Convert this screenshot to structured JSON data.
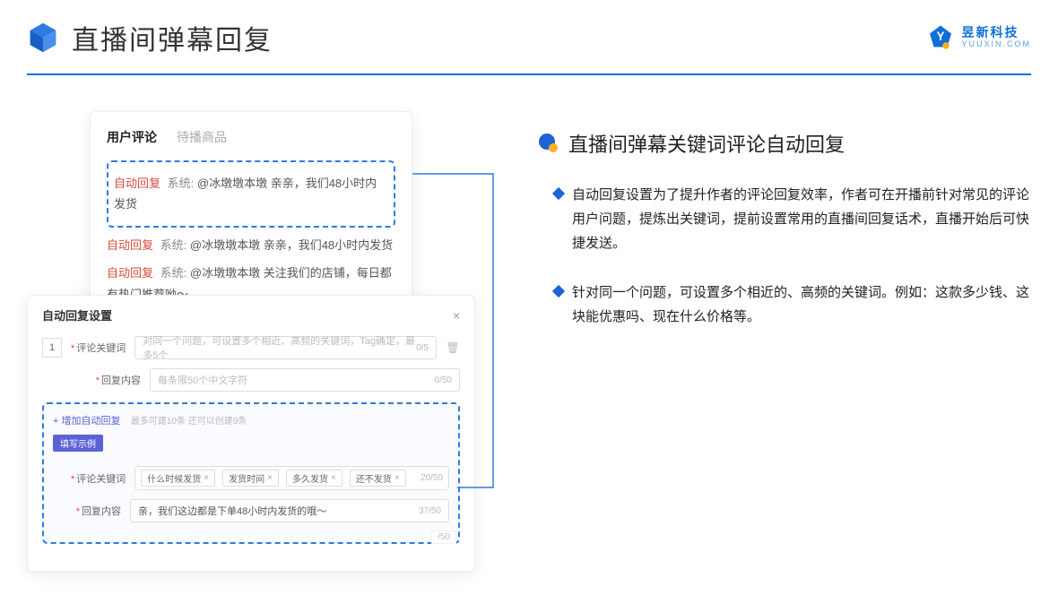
{
  "header": {
    "title": "直播间弹幕回复",
    "brand_name": "昱新科技",
    "brand_sub": "YUUXIN.COM"
  },
  "comments_card": {
    "tab_active": "用户评论",
    "tab_inactive": "待播商品",
    "highlight": {
      "tag": "自动回复",
      "sys": "系统:",
      "body": "@冰墩墩本墩 亲亲，我们48小时内发货"
    },
    "items": [
      {
        "tag": "自动回复",
        "sys": "系统:",
        "body": "@冰墩墩本墩 亲亲，我们48小时内发货"
      },
      {
        "tag": "自动回复",
        "sys": "系统:",
        "body": "@冰墩墩本墩 关注我们的店铺，每日都有热门推荐呦～"
      }
    ]
  },
  "settings": {
    "title": "自动回复设置",
    "idx": "1",
    "kw_label": "评论关键词",
    "kw_placeholder": "对同一个问题，可设置多个相近、高频的关键词，Tag确定，最多5个",
    "kw_count": "0/5",
    "rc_label": "回复内容",
    "rc_placeholder": "每条限50个中文字符",
    "rc_count": "0/50",
    "add_link": "+ 增加自动回复",
    "add_hint": "最多可建10条 还可以创建9条",
    "example_btn": "填写示例",
    "ex_kw_label": "评论关键词",
    "ex_chips": [
      "什么时候发货",
      "发货时间",
      "多久发货",
      "还不发货"
    ],
    "ex_kw_count": "20/50",
    "ex_rc_label": "回复内容",
    "ex_rc_value": "亲，我们这边都是下单48小时内发货的哦～",
    "ex_rc_count": "37/50",
    "ghost_count": "/50"
  },
  "right": {
    "section_title": "直播间弹幕关键词评论自动回复",
    "bullets": [
      "自动回复设置为了提升作者的评论回复效率，作者可在开播前针对常见的评论用户问题，提炼出关键词，提前设置常用的直播间回复话术，直播开始后可快捷发送。",
      "针对同一个问题，可设置多个相近的、高频的关键词。例如：这款多少钱、这块能优惠吗、现在什么价格等。"
    ]
  }
}
